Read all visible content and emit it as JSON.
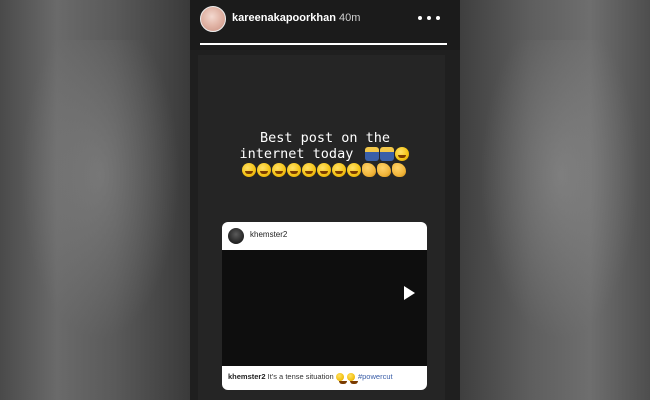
{
  "story": {
    "username": "kareenakapoorkhan",
    "time_ago": "40m",
    "more_label": "More options",
    "progress": 1.0,
    "caption_line1": "Best post on the",
    "caption_line2": "internet today",
    "inline_icons": [
      "people-dancing-icon",
      "people-dancing-icon",
      "rolling-laughing-icon"
    ],
    "emoji_row_icons": [
      "rolling-laughing-icon",
      "rolling-laughing-icon",
      "rolling-laughing-icon",
      "rolling-laughing-icon",
      "rolling-laughing-icon",
      "rolling-laughing-icon",
      "rolling-laughing-icon",
      "rolling-laughing-icon",
      "clapping-hands-icon",
      "clapping-hands-icon",
      "clapping-hands-icon"
    ]
  },
  "post": {
    "author": "khemster2",
    "caption_handle": "khemster2",
    "caption_text": "It's a tense situation",
    "caption_tag": "#powercut",
    "caption_icons": [
      "monkey-see-no-evil-icon",
      "grinning-sweat-icon"
    ]
  },
  "colors": {
    "story_bg": "#1f1f1f",
    "progress_fill": "#ffffff",
    "tag_color": "#3a5ea8"
  }
}
